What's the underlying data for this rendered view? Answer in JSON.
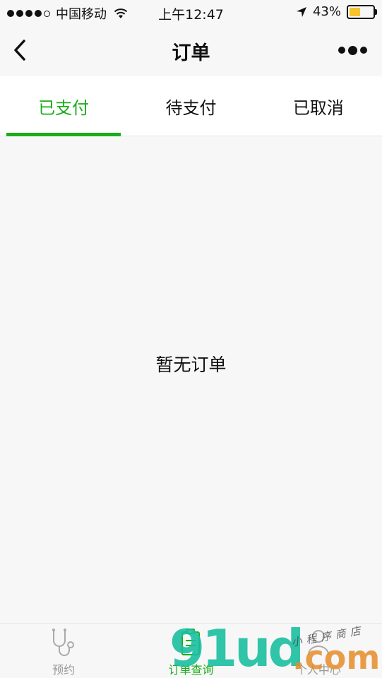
{
  "status_bar": {
    "carrier": "中国移动",
    "time": "上午12:47",
    "battery": "43%",
    "battery_level": 0.43,
    "signal_bars": 4,
    "signal_total": 5
  },
  "nav": {
    "title": "订单",
    "back_icon": "chevron-left-icon",
    "more_icon": "more-dots-icon"
  },
  "tabs": [
    {
      "label": "已支付",
      "active": true
    },
    {
      "label": "待支付",
      "active": false
    },
    {
      "label": "已取消",
      "active": false
    }
  ],
  "empty_state": {
    "text": "暂无订单"
  },
  "tab_bar": [
    {
      "label": "预约",
      "icon": "stethoscope-icon",
      "active": false
    },
    {
      "label": "订单查询",
      "icon": "clipboard-icon",
      "active": true
    },
    {
      "label": "个人中心",
      "icon": "person-icon",
      "active": false
    }
  ],
  "watermark": {
    "main": "91ud",
    "suffix": ".com",
    "small": "小程序商店"
  },
  "colors": {
    "accent": "#1aad19",
    "background": "#f7f7f7",
    "battery": "#f7c32e"
  }
}
